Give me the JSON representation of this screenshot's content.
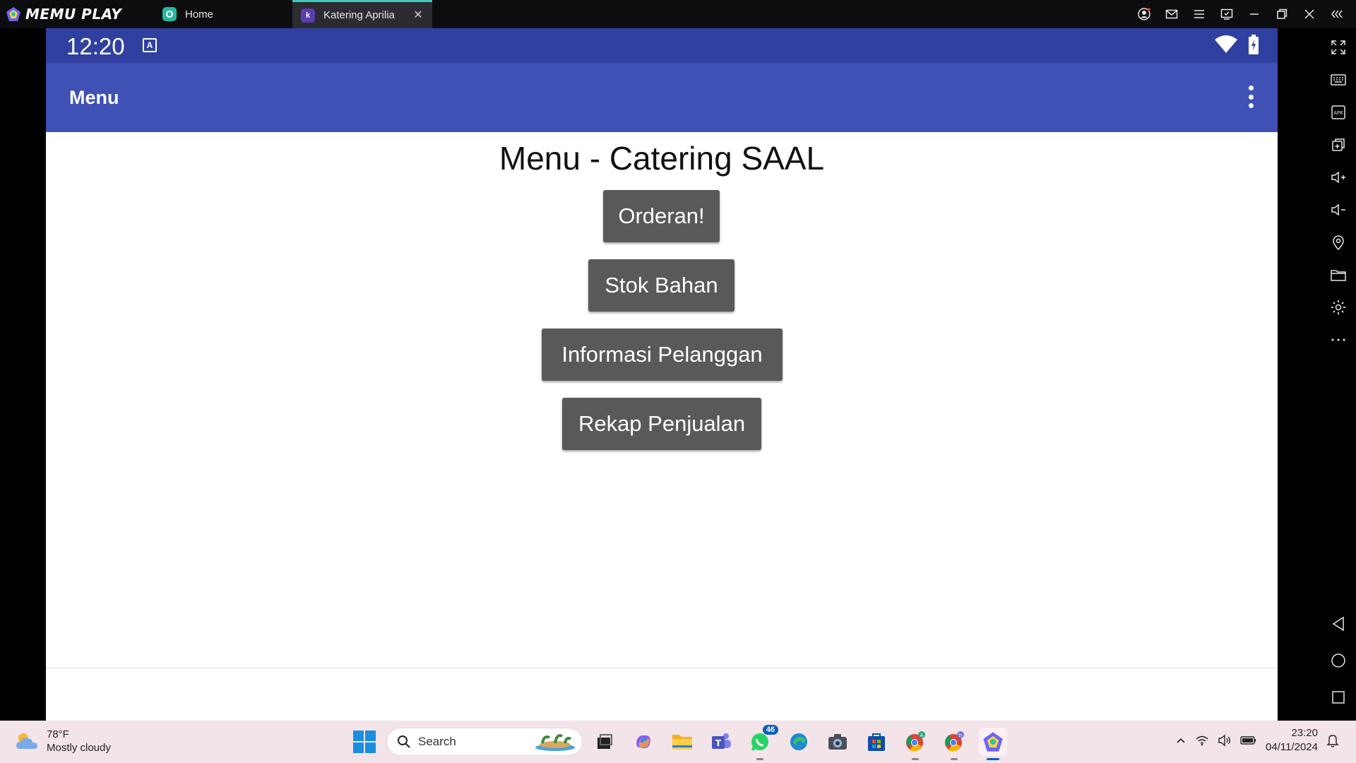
{
  "emulator": {
    "brand": "MEMU PLAY",
    "tabs": [
      {
        "label": "Home"
      },
      {
        "label": "Katering Aprilia"
      }
    ]
  },
  "android": {
    "status": {
      "time": "12:20"
    },
    "appbar": {
      "title": "Menu"
    },
    "heading": "Menu - Catering SAAL",
    "buttons": {
      "orderan": "Orderan!",
      "stok": "Stok Bahan",
      "informasi": "Informasi Pelanggan",
      "rekap": "Rekap Penjualan"
    },
    "colors": {
      "statusbar": "#3040a0",
      "appbar": "#3f51b5",
      "button": "#595959"
    }
  },
  "taskbar": {
    "weather": {
      "temp": "78°F",
      "condition": "Mostly cloudy"
    },
    "search_placeholder": "Search",
    "whatsapp_badge": "46",
    "clock": {
      "time": "23:20",
      "date": "04/11/2024"
    }
  }
}
